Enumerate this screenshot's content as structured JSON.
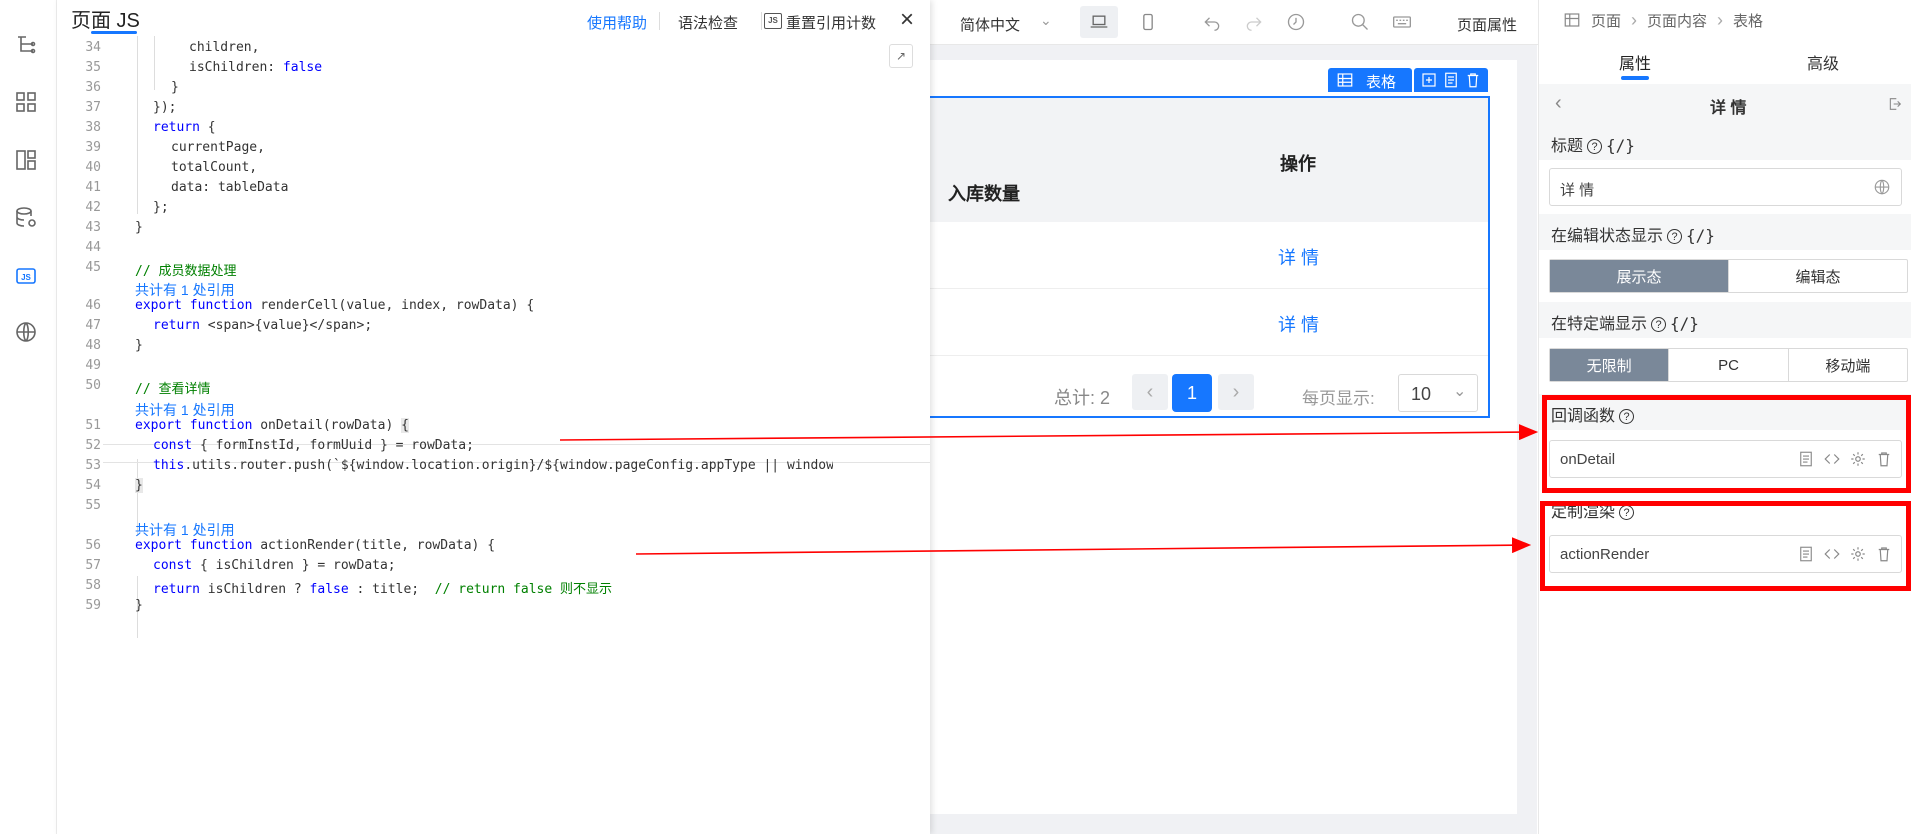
{
  "code_panel": {
    "title": "页面 JS",
    "help_link": "使用帮助",
    "syntax_check": "语法检查",
    "reset_ref_count": "重置引用计数",
    "js_badge": "JS",
    "lines": [
      {
        "n": "34",
        "text": "children,"
      },
      {
        "n": "35",
        "text": "isChildren: false"
      },
      {
        "n": "36",
        "text": "}"
      },
      {
        "n": "37",
        "text": "});"
      },
      {
        "n": "38",
        "text": "return {"
      },
      {
        "n": "39",
        "text": "currentPage,"
      },
      {
        "n": "40",
        "text": "totalCount,"
      },
      {
        "n": "41",
        "text": "data: tableData"
      },
      {
        "n": "42",
        "text": "};"
      },
      {
        "n": "43",
        "text": "}"
      },
      {
        "n": "44",
        "text": ""
      },
      {
        "n": "45",
        "text": "// 成员数据处理"
      },
      {
        "n": "46",
        "text": "export function renderCell(value, index, rowData) {"
      },
      {
        "n": "47",
        "text": "return <span>{value}</span>;"
      },
      {
        "n": "48",
        "text": "}"
      },
      {
        "n": "49",
        "text": ""
      },
      {
        "n": "50",
        "text": "// 查看详情"
      },
      {
        "n": "51",
        "text": "export function onDetail(rowData) {"
      },
      {
        "n": "52",
        "text": "const { formInstId, formUuid } = rowData;"
      },
      {
        "n": "53",
        "text": "this.utils.router.push(`${window.location.origin}/${window.pageConfig.appType || window"
      },
      {
        "n": "54",
        "text": "}"
      },
      {
        "n": "55",
        "text": ""
      },
      {
        "n": "56",
        "text": "export function actionRender(title, rowData) {"
      },
      {
        "n": "57",
        "text": "const { isChildren } = rowData;"
      },
      {
        "n": "58",
        "text": "return isChildren ? false : title;  // return false 则不显示"
      },
      {
        "n": "59",
        "text": "}"
      }
    ],
    "ref_note": "共计有 1 处引用"
  },
  "toolbar": {
    "language": "简体中文",
    "page_props": "页面属性"
  },
  "table": {
    "badge": "表格",
    "col_inbound": "入库数量",
    "col_action": "操作",
    "rows": [
      "详 情",
      "详 情"
    ],
    "total": "总计: 2",
    "page_current": "1",
    "page_size_label": "每页显示:",
    "page_size": "10"
  },
  "right_panel": {
    "breadcrumb": [
      "页面",
      "页面内容",
      "表格"
    ],
    "tab_props": "属性",
    "tab_advanced": "高级",
    "section_title": "详 情",
    "label_title": "标题",
    "title_value": "详 情",
    "label_edit_state": "在编辑状态显示",
    "edit_state_options": [
      "展示态",
      "编辑态"
    ],
    "label_terminal": "在特定端显示",
    "terminal_options": [
      "无限制",
      "PC",
      "移动端"
    ],
    "label_callback": "回调函数",
    "callback_value": "onDetail",
    "label_custom_render": "定制渲染",
    "custom_render_value": "actionRender"
  },
  "colors": {
    "accent": "#1677ff",
    "highlight": "#ff0000",
    "segment_active": "#7a8899"
  }
}
